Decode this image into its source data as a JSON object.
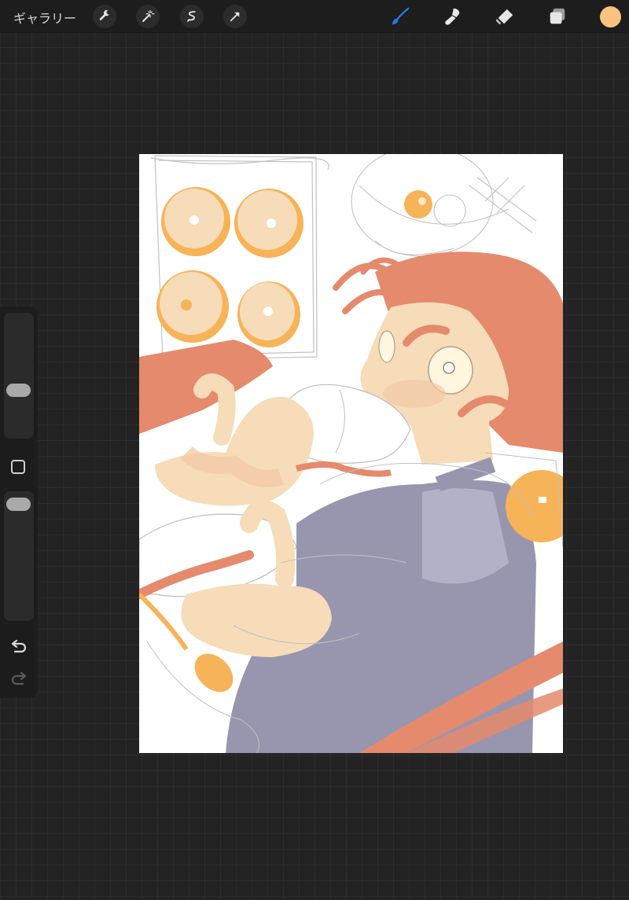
{
  "toolbar": {
    "gallery_label": "ギャラリー",
    "left_tools": [
      "wrench-icon",
      "magic-wand-icon",
      "selection-icon",
      "transform-arrow-icon"
    ],
    "right_tools": [
      "brush-icon",
      "smudge-icon",
      "eraser-icon",
      "layers-icon"
    ],
    "active_tool": "brush",
    "current_color": "#f9c27f"
  },
  "sidebar": {
    "controls": [
      "brush-size-slider",
      "modify-button",
      "opacity-slider",
      "undo-button",
      "redo-button"
    ]
  },
  "colors": {
    "background": "#232323",
    "accent_blue": "#1e7cf2",
    "skin": "#f6dcb8",
    "hair": "#e58a6c",
    "shirt": "#9896ae",
    "donut": "#f7b357",
    "sketch": "#b8b8b8"
  }
}
